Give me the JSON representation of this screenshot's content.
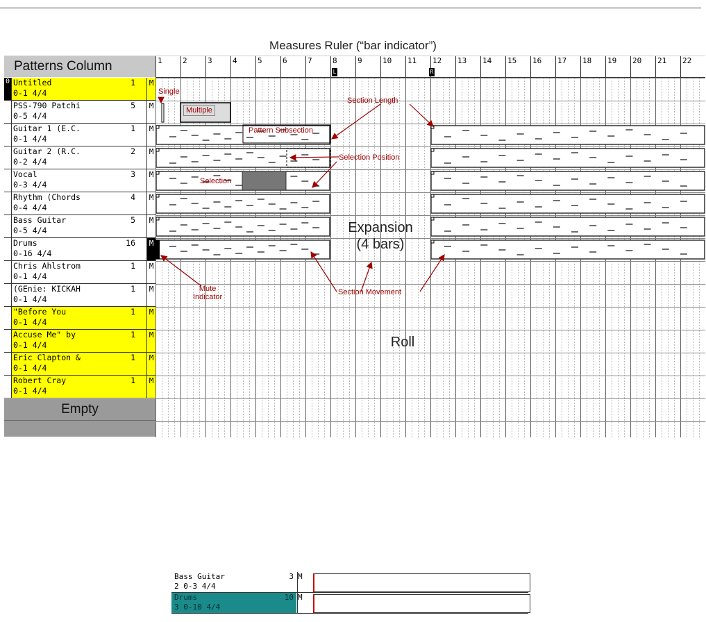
{
  "title": "Measures Ruler (“bar indicator”)",
  "patterns_header": "Patterns Column",
  "empty_label": "Empty",
  "ruler": {
    "bars": [
      "1",
      "2",
      "3",
      "4",
      "5",
      "6",
      "7",
      "8",
      "9",
      "10",
      "11",
      "12",
      "13",
      "14",
      "15",
      "16",
      "17",
      "18",
      "19",
      "20",
      "21",
      "22"
    ],
    "left_marker": "L",
    "right_marker": "R"
  },
  "patterns": [
    {
      "slot": "0",
      "name": "Untitled",
      "sub": "0-1 4/4",
      "count": "1",
      "mute": "M",
      "highlight": true
    },
    {
      "slot": "",
      "name": "PSS-790 Patchi",
      "sub": "0-5 4/4",
      "count": "5",
      "mute": "M",
      "highlight": false
    },
    {
      "slot": "",
      "name": "Guitar 1 (E.C.",
      "sub": "0-1 4/4",
      "count": "1",
      "mute": "M",
      "highlight": false
    },
    {
      "slot": "",
      "name": "Guitar 2 (R.C.",
      "sub": "0-2 4/4",
      "count": "2",
      "mute": "M",
      "highlight": false
    },
    {
      "slot": "",
      "name": "Vocal",
      "sub": "0-3 4/4",
      "count": "3",
      "mute": "M",
      "highlight": false
    },
    {
      "slot": "",
      "name": "Rhythm (Chords",
      "sub": "0-4 4/4",
      "count": "4",
      "mute": "M",
      "highlight": false
    },
    {
      "slot": "",
      "name": "Bass Guitar",
      "sub": "0-5 4/4",
      "count": "5",
      "mute": "M",
      "highlight": false
    },
    {
      "slot": "",
      "name": "Drums",
      "sub": "0-16 4/4",
      "count": "16",
      "mute": "M",
      "highlight": false,
      "muted": true
    },
    {
      "slot": "",
      "name": "Chris Ahlstrom",
      "sub": "0-1 4/4",
      "count": "1",
      "mute": "M",
      "highlight": false
    },
    {
      "slot": "",
      "name": "(GEnie: KICKAH",
      "sub": "0-1 4/4",
      "count": "1",
      "mute": "M",
      "highlight": false
    },
    {
      "slot": "",
      "name": "\"Before You",
      "sub": "0-1 4/4",
      "count": "1",
      "mute": "M",
      "highlight": true
    },
    {
      "slot": "",
      "name": "Accuse Me\" by",
      "sub": "0-1 4/4",
      "count": "1",
      "mute": "M",
      "highlight": true
    },
    {
      "slot": "",
      "name": "Eric Clapton &",
      "sub": "0-1 4/4",
      "count": "1",
      "mute": "M",
      "highlight": true
    },
    {
      "slot": "",
      "name": "Robert Cray",
      "sub": "0-1 4/4",
      "count": "1",
      "mute": "M",
      "highlight": true
    }
  ],
  "annotations": {
    "single": "Single",
    "multiple": "Multiple",
    "section_length": "Section Length",
    "pattern_subsection": "Pattern Subsection",
    "selection_position": "Selection Position",
    "selection": "Selection",
    "mute_indicator_1": "Mute",
    "mute_indicator_2": "Indicator",
    "section_movement": "Section Movement",
    "expansion_1": "Expansion",
    "expansion_2": "(4 bars)",
    "roll": "Roll"
  },
  "thumbnail": {
    "rows": [
      {
        "name": "Bass Guitar",
        "sub": "2  0-3 4/4",
        "count": "3",
        "mute": "M",
        "color": "#ffffff",
        "text_color": "#000000"
      },
      {
        "name": "Drums",
        "sub": "3  0-10 4/4",
        "count": "10",
        "mute": "M",
        "color": "#1a8a8a",
        "text_color": "#003030"
      }
    ]
  },
  "colors": {
    "highlight": "#ffff00",
    "annotation": "#a00000",
    "header": "#c8c8c8",
    "empty": "#9a9a9a",
    "thumb_teal": "#1a8a8a"
  }
}
